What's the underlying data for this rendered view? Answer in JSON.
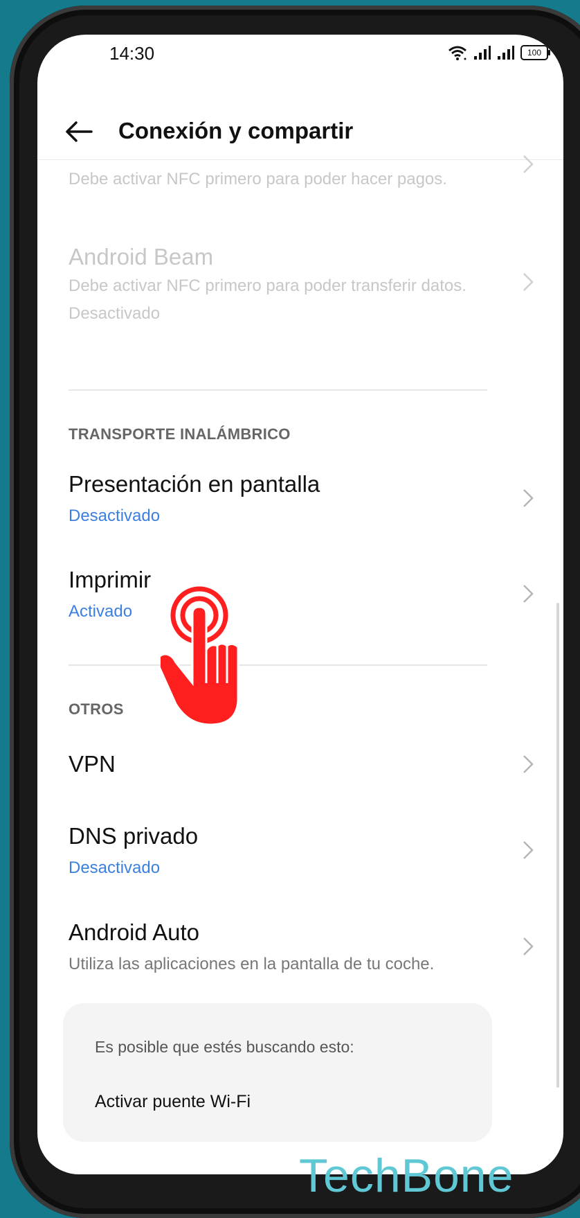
{
  "status_bar": {
    "time": "14:30",
    "battery": "100"
  },
  "header": {
    "title": "Conexión y compartir"
  },
  "items": {
    "payment": {
      "subtitle": "Debe activar NFC primero para poder hacer pagos."
    },
    "android_beam": {
      "title": "Android Beam",
      "subtitle": "Debe activar NFC primero para poder transferir datos.",
      "status": "Desactivado"
    },
    "screencast": {
      "title": "Presentación en pantalla",
      "status": "Desactivado"
    },
    "print": {
      "title": "Imprimir",
      "status": "Activado"
    },
    "vpn": {
      "title": "VPN"
    },
    "private_dns": {
      "title": "DNS privado",
      "status": "Desactivado"
    },
    "android_auto": {
      "title": "Android Auto",
      "subtitle": "Utiliza las aplicaciones en la pantalla de tu coche."
    }
  },
  "sections": {
    "wireless": "TRANSPORTE INALÁMBRICO",
    "others": "OTROS"
  },
  "suggestions": {
    "label": "Es posible que estés buscando esto:",
    "item": "Activar puente Wi-Fi"
  },
  "watermark": "TechBone",
  "colors": {
    "accent": "#3b7fe0",
    "background": "#147a8c",
    "tap_indicator": "#ff1f1f"
  }
}
